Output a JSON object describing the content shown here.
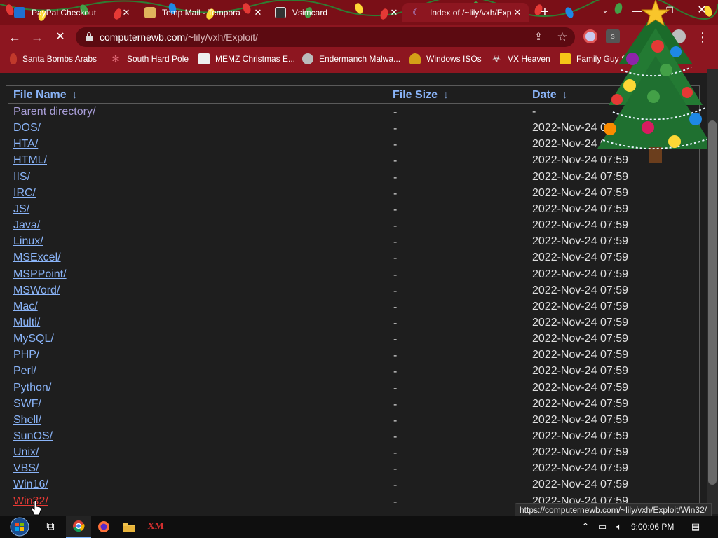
{
  "tabs": [
    {
      "title": "PayPal Checkout",
      "favicon_color": "#1f6fd1",
      "active": false
    },
    {
      "title": "Temp Mail - Tempora",
      "favicon_color": "#e0b45c",
      "active": false
    },
    {
      "title": "Vsimcard",
      "favicon_color": "#333333",
      "active": false
    },
    {
      "title": "Index of /~lily/vxh/Exp",
      "favicon_color": "#3a2a5c",
      "active": true
    }
  ],
  "toolbar": {
    "back_icon": "←",
    "forward_icon": "→",
    "stop_icon": "✕",
    "url_host": "computernewb.com",
    "url_path": "/~lily/vxh/Exploit/",
    "share_icon": "⇪",
    "star_icon": "☆",
    "menu_icon": "⋮"
  },
  "bookmarks": [
    {
      "label": "Santa Bombs Arabs",
      "icon_color": "#c0392b"
    },
    {
      "label": "South Hard Pole",
      "icon_color": "#9b1b2a"
    },
    {
      "label": "MEMZ Christmas E...",
      "icon_color": "#dddddd"
    },
    {
      "label": "Endermanch Malwa...",
      "icon_color": "#bbbbbb"
    },
    {
      "label": "Windows ISOs",
      "icon_color": "#d4a017"
    },
    {
      "label": "VX Heaven",
      "icon_color": "#cccccc"
    },
    {
      "label": "Family Guy S",
      "icon_color": "#f5c518"
    }
  ],
  "listing": {
    "headers": {
      "name": "File Name",
      "size": "File Size",
      "date": "Date",
      "sort_arrow": "↓"
    },
    "rows": [
      {
        "name": "Parent directory/",
        "size": "-",
        "date": "-",
        "state": "visited"
      },
      {
        "name": "DOS/",
        "size": "-",
        "date": "2022-Nov-24 07:59",
        "state": "link"
      },
      {
        "name": "HTA/",
        "size": "-",
        "date": "2022-Nov-24 07:59",
        "state": "link"
      },
      {
        "name": "HTML/",
        "size": "-",
        "date": "2022-Nov-24 07:59",
        "state": "link"
      },
      {
        "name": "IIS/",
        "size": "-",
        "date": "2022-Nov-24 07:59",
        "state": "link"
      },
      {
        "name": "IRC/",
        "size": "-",
        "date": "2022-Nov-24 07:59",
        "state": "link"
      },
      {
        "name": "JS/",
        "size": "-",
        "date": "2022-Nov-24 07:59",
        "state": "link"
      },
      {
        "name": "Java/",
        "size": "-",
        "date": "2022-Nov-24 07:59",
        "state": "link"
      },
      {
        "name": "Linux/",
        "size": "-",
        "date": "2022-Nov-24 07:59",
        "state": "link"
      },
      {
        "name": "MSExcel/",
        "size": "-",
        "date": "2022-Nov-24 07:59",
        "state": "link"
      },
      {
        "name": "MSPPoint/",
        "size": "-",
        "date": "2022-Nov-24 07:59",
        "state": "link"
      },
      {
        "name": "MSWord/",
        "size": "-",
        "date": "2022-Nov-24 07:59",
        "state": "link"
      },
      {
        "name": "Mac/",
        "size": "-",
        "date": "2022-Nov-24 07:59",
        "state": "link"
      },
      {
        "name": "Multi/",
        "size": "-",
        "date": "2022-Nov-24 07:59",
        "state": "link"
      },
      {
        "name": "MySQL/",
        "size": "-",
        "date": "2022-Nov-24 07:59",
        "state": "link"
      },
      {
        "name": "PHP/",
        "size": "-",
        "date": "2022-Nov-24 07:59",
        "state": "link"
      },
      {
        "name": "Perl/",
        "size": "-",
        "date": "2022-Nov-24 07:59",
        "state": "link"
      },
      {
        "name": "Python/",
        "size": "-",
        "date": "2022-Nov-24 07:59",
        "state": "link"
      },
      {
        "name": "SWF/",
        "size": "-",
        "date": "2022-Nov-24 07:59",
        "state": "link"
      },
      {
        "name": "Shell/",
        "size": "-",
        "date": "2022-Nov-24 07:59",
        "state": "link"
      },
      {
        "name": "SunOS/",
        "size": "-",
        "date": "2022-Nov-24 07:59",
        "state": "link"
      },
      {
        "name": "Unix/",
        "size": "-",
        "date": "2022-Nov-24 07:59",
        "state": "link"
      },
      {
        "name": "VBS/",
        "size": "-",
        "date": "2022-Nov-24 07:59",
        "state": "link"
      },
      {
        "name": "Win16/",
        "size": "-",
        "date": "2022-Nov-24 07:59",
        "state": "link"
      },
      {
        "name": "Win32/",
        "size": "-",
        "date": "2022-Nov-24 07:59",
        "state": "hover"
      }
    ]
  },
  "status_bar": {
    "url": "https://computernewb.com/~lily/vxh/Exploit/Win32/"
  },
  "taskbar": {
    "apps": [
      "start-orb",
      "task-view",
      "chrome",
      "firefox",
      "file-explorer",
      "xm-app"
    ],
    "tray_icons": [
      "chevron-up",
      "network",
      "volume"
    ],
    "clock": "9:00:06 PM"
  },
  "colors": {
    "chrome_frame": "#8d1620",
    "link": "#8ab4f8",
    "visited_link": "#a99ed8",
    "hover_link": "#e53935",
    "page_bg": "#1e1e1e"
  }
}
